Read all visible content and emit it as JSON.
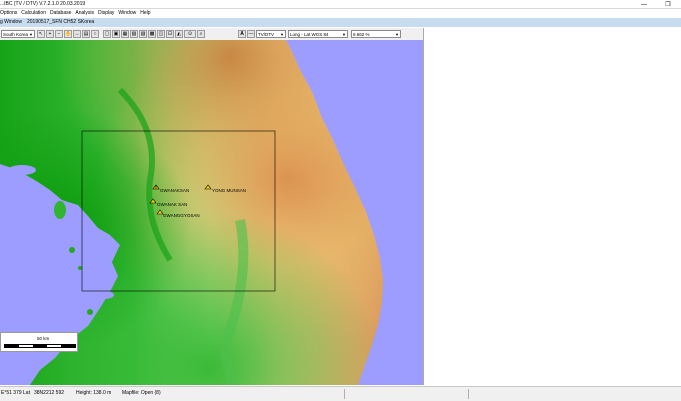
{
  "app": {
    "title": "...IBC (TV / DTV) V.7.2.1.0 20.03.2019",
    "controls": {
      "minimize": "—",
      "restore": "❐"
    }
  },
  "menu": [
    "Options",
    "Calculation",
    "Database",
    "Analysis",
    "Display",
    "Window",
    "Help"
  ],
  "subwindow": {
    "label": "g Window",
    "project": "20190517_SFN CH52 SKorea"
  },
  "toolbar": {
    "region": "South Korea",
    "service": "TV/DTV",
    "coords": "Long - Lat  WGS 84",
    "zoom": "6.662 %",
    "icons": [
      "pointer-icon",
      "zoom-in-icon",
      "zoom-out-icon",
      "pan-icon",
      "ruler-icon",
      "print-icon",
      "select-icon",
      "area-icon",
      "tool-a-icon",
      "tool-b-icon",
      "tool-c-icon",
      "tool-d-icon",
      "tool-e-icon",
      "tool-f-icon",
      "tool-g-icon",
      "terrain-icon",
      "binoculars-icon",
      "text-icon",
      "line-icon",
      "grid-icon",
      "compass-icon"
    ]
  },
  "map": {
    "sites": [
      {
        "name": "GWANAKSAN"
      },
      {
        "name": "YONG MUNSAN"
      },
      {
        "name": "GWANAK SAN"
      },
      {
        "name": "GWANGGYOSAN"
      }
    ],
    "scale_label": "50 km"
  },
  "status": {
    "long": "E°51 379 Lat",
    "lat": "38N2212 592",
    "height": "Height: 138.0 m",
    "mapinfo": "Mapfile: Open (8)"
  },
  "colors": {
    "sea": "#9d9dff",
    "lowland": "#1ea01e",
    "midland": "#9be37d",
    "upland": "#e9b866",
    "highland": "#d98c52"
  }
}
